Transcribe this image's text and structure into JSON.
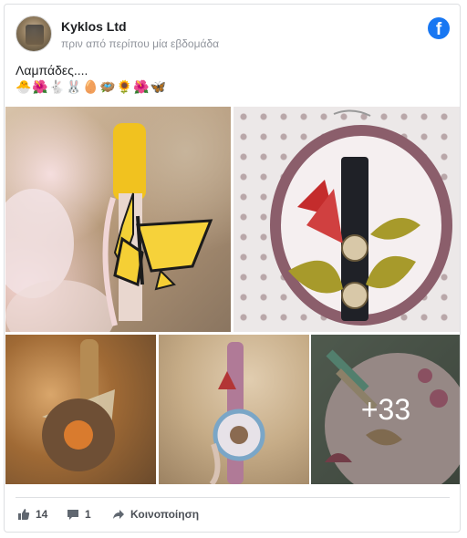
{
  "post": {
    "page_name": "Kyklos Ltd",
    "time": "πριν από περίπου μία εβδομάδα",
    "text": "Λαμπάδες....",
    "emojis": "🐣🌺🐇🐰🥚🪺🌻🌺🦋"
  },
  "gallery": {
    "more_count": "+33"
  },
  "footer": {
    "likes": "14",
    "comments": "1",
    "share_label": "Κοινοποίηση"
  },
  "colors": {
    "facebook_blue": "#1877f2",
    "muted_text": "#90949c"
  },
  "icons": [
    "facebook-icon",
    "like-icon",
    "comment-icon",
    "share-icon"
  ]
}
